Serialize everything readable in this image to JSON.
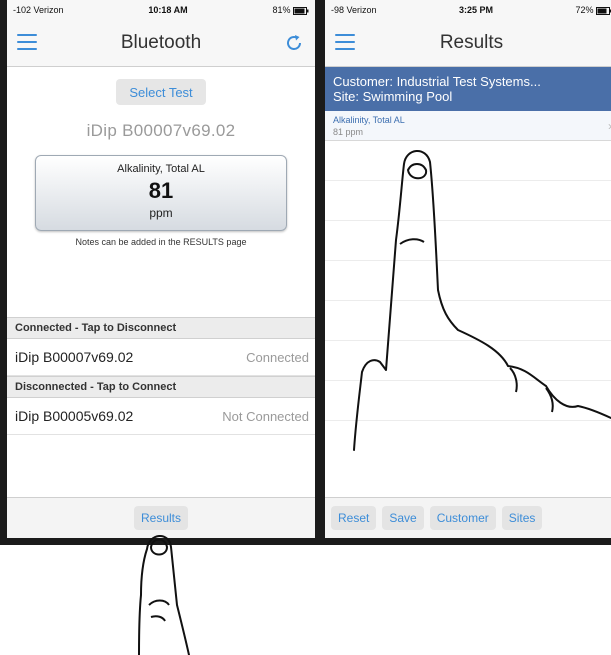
{
  "left_screen": {
    "status": {
      "carrier": "-102 Verizon",
      "time": "10:18 AM",
      "battery": "81%"
    },
    "title": "Bluetooth",
    "select_test_label": "Select Test",
    "device_heading": "iDip  B00007v69.02",
    "reading": {
      "test_name": "Alkalinity, Total AL",
      "value": "81",
      "unit": "ppm"
    },
    "notes": "Notes can be added in the RESULTS page",
    "connected_header": "Connected - Tap to Disconnect",
    "connected_devices": [
      {
        "name": "iDip  B00007v69.02",
        "status": "Connected"
      }
    ],
    "disconnected_header": "Disconnected - Tap to Connect",
    "disconnected_devices": [
      {
        "name": "iDip  B00005v69.02",
        "status": "Not Connected"
      }
    ],
    "results_button": "Results"
  },
  "right_screen": {
    "status": {
      "carrier": "-98 Verizon",
      "time": "3:25 PM",
      "battery": "72%"
    },
    "title": "Results",
    "customer_line": "Customer: Industrial Test Systems...",
    "site_line": "Site: Swimming Pool",
    "results": [
      {
        "name": "Alkalinity, Total AL",
        "value": "81 ppm"
      }
    ],
    "buttons": {
      "reset": "Reset",
      "save": "Save",
      "customer": "Customer",
      "sites": "Sites"
    }
  },
  "colors": {
    "accent": "#3d8dd8",
    "header_blue": "#4a6fa8"
  },
  "icons": [
    "hamburger-icon",
    "refresh-icon",
    "wifi-icon",
    "battery-icon",
    "chevron-right-icon",
    "pointing-hand-icon"
  ]
}
